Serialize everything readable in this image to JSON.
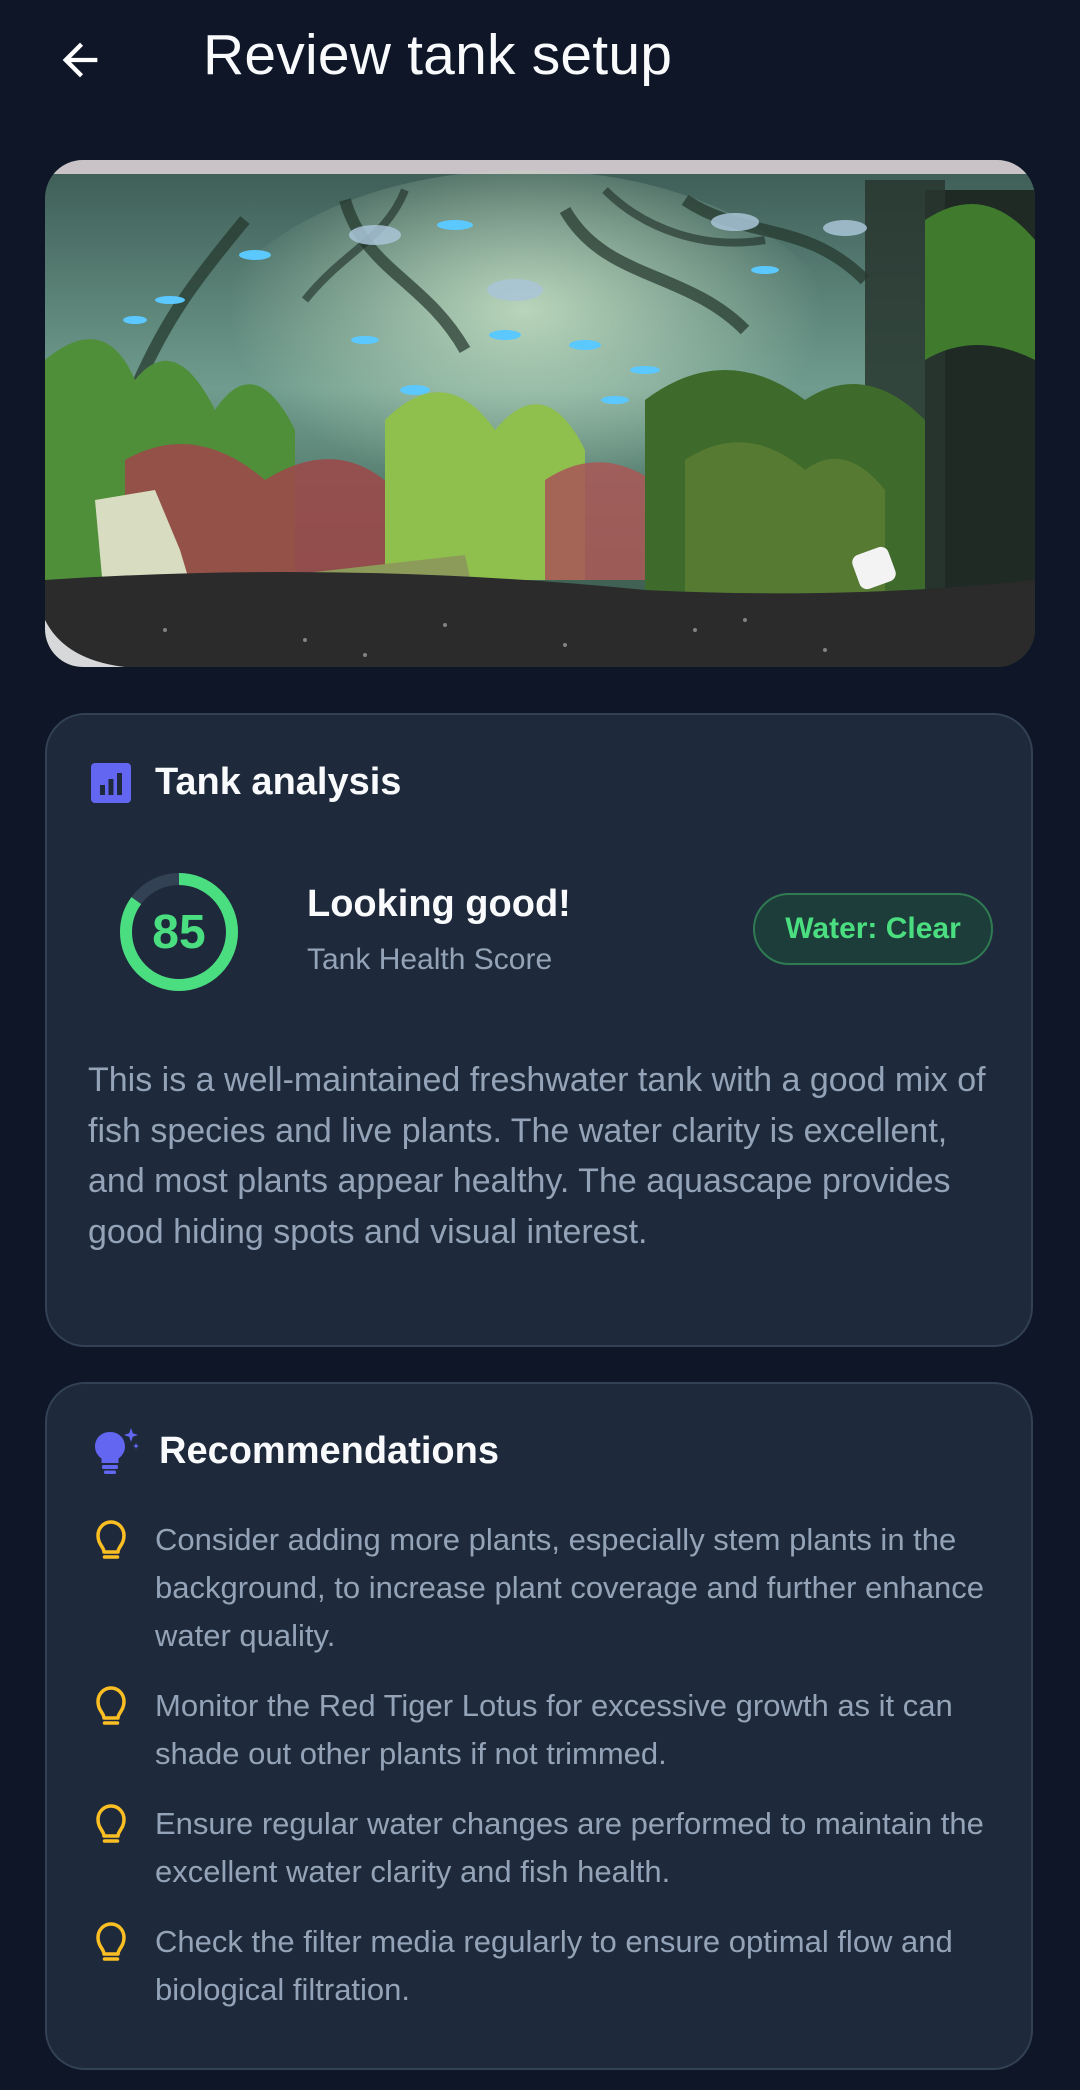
{
  "header": {
    "title": "Review tank setup"
  },
  "analysis": {
    "title": "Tank analysis",
    "score": "85",
    "score_fraction": 0.85,
    "status": "Looking good!",
    "score_label": "Tank Health Score",
    "water_badge": "Water: Clear",
    "description": "This is a well-maintained freshwater tank with a good mix of fish species and live plants. The water clarity is excellent, and most plants appear healthy. The aquascape provides good hiding spots and visual interest."
  },
  "recommendations": {
    "title": "Recommendations",
    "items": [
      "Consider adding more plants, especially stem plants in the background, to increase plant coverage and further enhance water quality.",
      "Monitor the Red Tiger Lotus for excessive growth as it can shade out other plants if not trimmed.",
      "Ensure regular water changes are performed to maintain the excellent water clarity and fish health.",
      "Check the filter media regularly to ensure optimal flow and biological filtration."
    ]
  },
  "colors": {
    "background": "#0e1627",
    "card": "#1e293b",
    "accent": "#6366f1",
    "success": "#4ade80",
    "warning": "#fbbf24"
  },
  "icons": {
    "back": "arrow-left-icon",
    "analysis": "chart-icon",
    "recommendations": "lightbulb-sparkle-icon",
    "item": "lightbulb-outline-icon"
  }
}
